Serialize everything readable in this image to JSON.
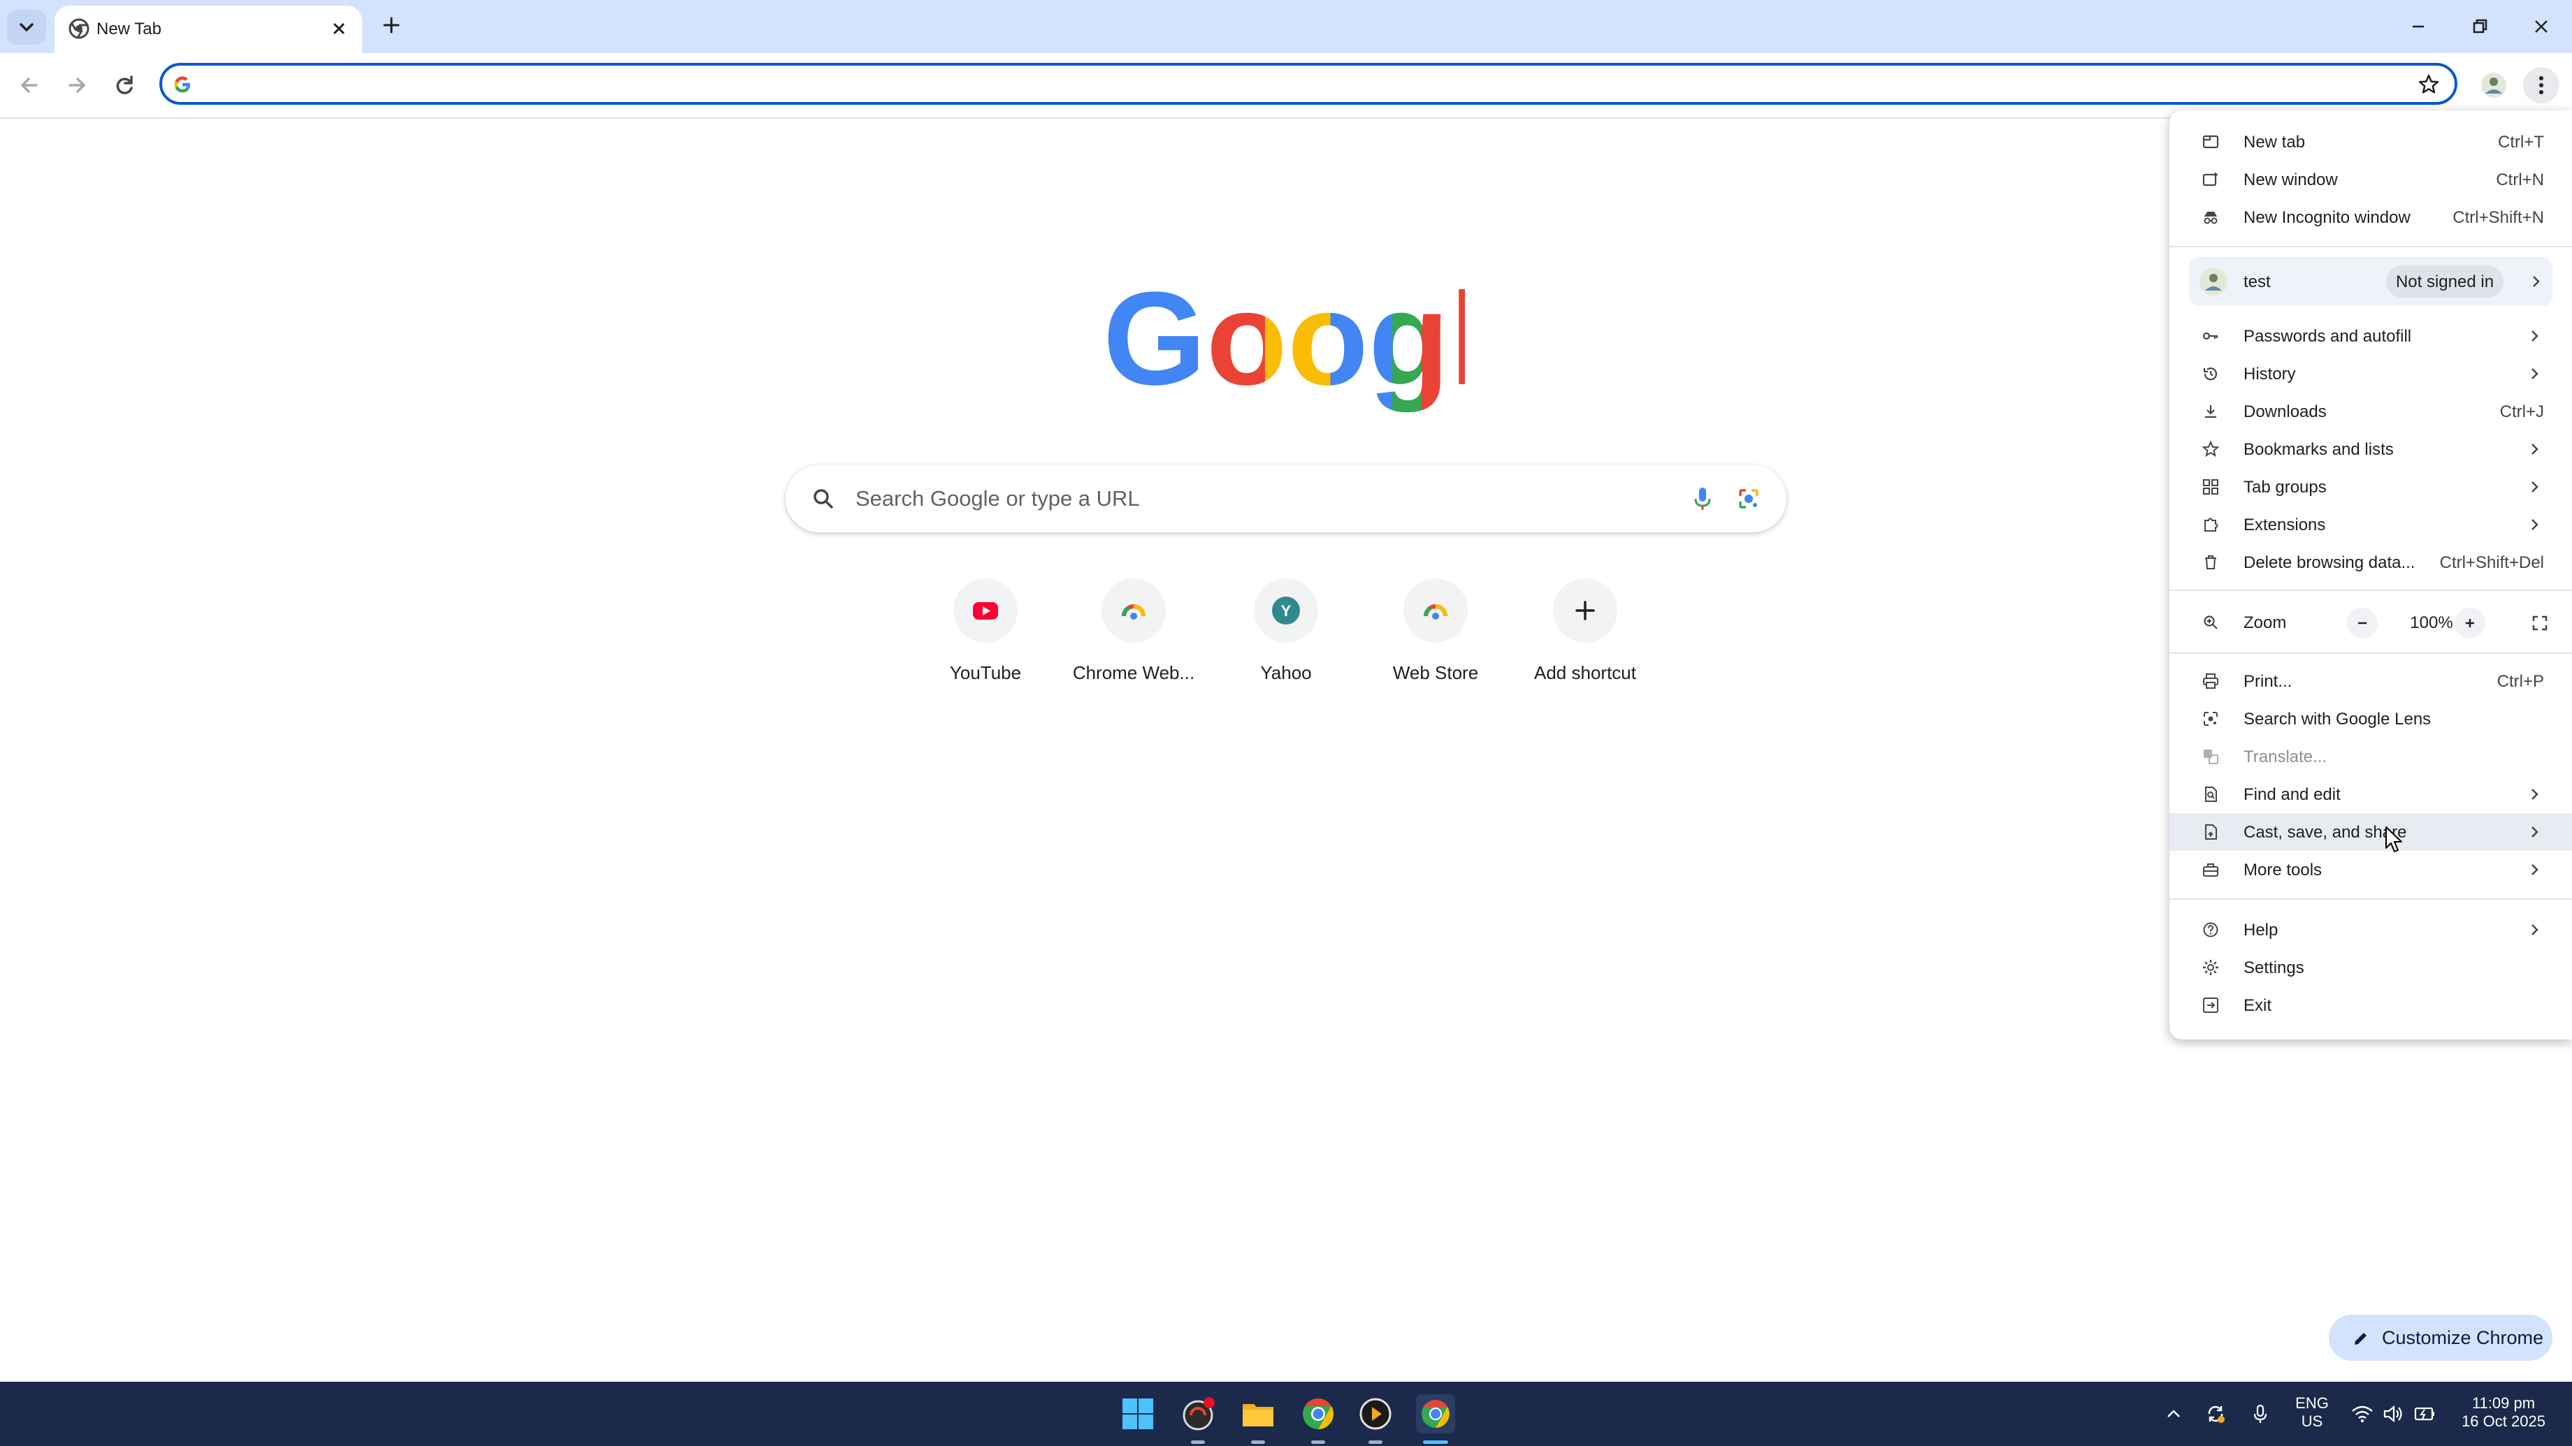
{
  "colors": {
    "accent": "#0b57d0",
    "tabstrip": "#d3e3fd",
    "taskbar": "#1b2a4a",
    "google_blue": "#4285f4",
    "google_red": "#ea4335",
    "google_yellow": "#fbbc05",
    "google_green": "#34a853"
  },
  "browser": {
    "tab": {
      "title": "New Tab",
      "favicon": "chrome-icon",
      "close_icon": "close-icon"
    },
    "new_tab_icon": "plus-icon",
    "window_controls": [
      "minimize-icon",
      "restore-icon",
      "close-icon"
    ],
    "omnibox": {
      "value": "",
      "placeholder": ""
    }
  },
  "ntp": {
    "logo_text": "Google",
    "search": {
      "placeholder": "Search Google or type a URL"
    },
    "shortcuts": [
      {
        "label": "YouTube",
        "icon": "youtube-icon"
      },
      {
        "label": "Chrome Web...",
        "icon": "chrome-web-store-icon"
      },
      {
        "label": "Yahoo",
        "icon": "yahoo-icon",
        "letter": "Y"
      },
      {
        "label": "Web Store",
        "icon": "chrome-web-store-icon"
      },
      {
        "label": "Add shortcut",
        "icon": "plus-icon"
      }
    ],
    "customize_label": "Customize Chrome"
  },
  "menu": {
    "new_tab": {
      "label": "New tab",
      "shortcut": "Ctrl+T"
    },
    "new_window": {
      "label": "New window",
      "shortcut": "Ctrl+N"
    },
    "incognito": {
      "label": "New Incognito window",
      "shortcut": "Ctrl+Shift+N"
    },
    "profile": {
      "name": "test",
      "status": "Not signed in"
    },
    "passwords": {
      "label": "Passwords and autofill"
    },
    "history": {
      "label": "History"
    },
    "downloads": {
      "label": "Downloads",
      "shortcut": "Ctrl+J"
    },
    "bookmarks": {
      "label": "Bookmarks and lists"
    },
    "tab_groups": {
      "label": "Tab groups"
    },
    "extensions": {
      "label": "Extensions"
    },
    "delete_data": {
      "label": "Delete browsing data...",
      "shortcut": "Ctrl+Shift+Del"
    },
    "zoom": {
      "label": "Zoom",
      "value": "100%",
      "minus": "−",
      "plus": "+"
    },
    "print": {
      "label": "Print...",
      "shortcut": "Ctrl+P"
    },
    "lens": {
      "label": "Search with Google Lens"
    },
    "translate": {
      "label": "Translate..."
    },
    "find_edit": {
      "label": "Find and edit"
    },
    "cast_save": {
      "label": "Cast, save, and share"
    },
    "more_tools": {
      "label": "More tools"
    },
    "help": {
      "label": "Help"
    },
    "settings": {
      "label": "Settings"
    },
    "exit": {
      "label": "Exit"
    }
  },
  "taskbar": {
    "apps": [
      "windows-start-icon",
      "app-icon",
      "file-explorer-icon",
      "chrome-icon",
      "media-player-icon",
      "chrome-icon"
    ],
    "language": {
      "line1": "ENG",
      "line2": "US"
    },
    "clock": {
      "time": "11:09 pm",
      "date": "16 Oct 2025"
    }
  }
}
